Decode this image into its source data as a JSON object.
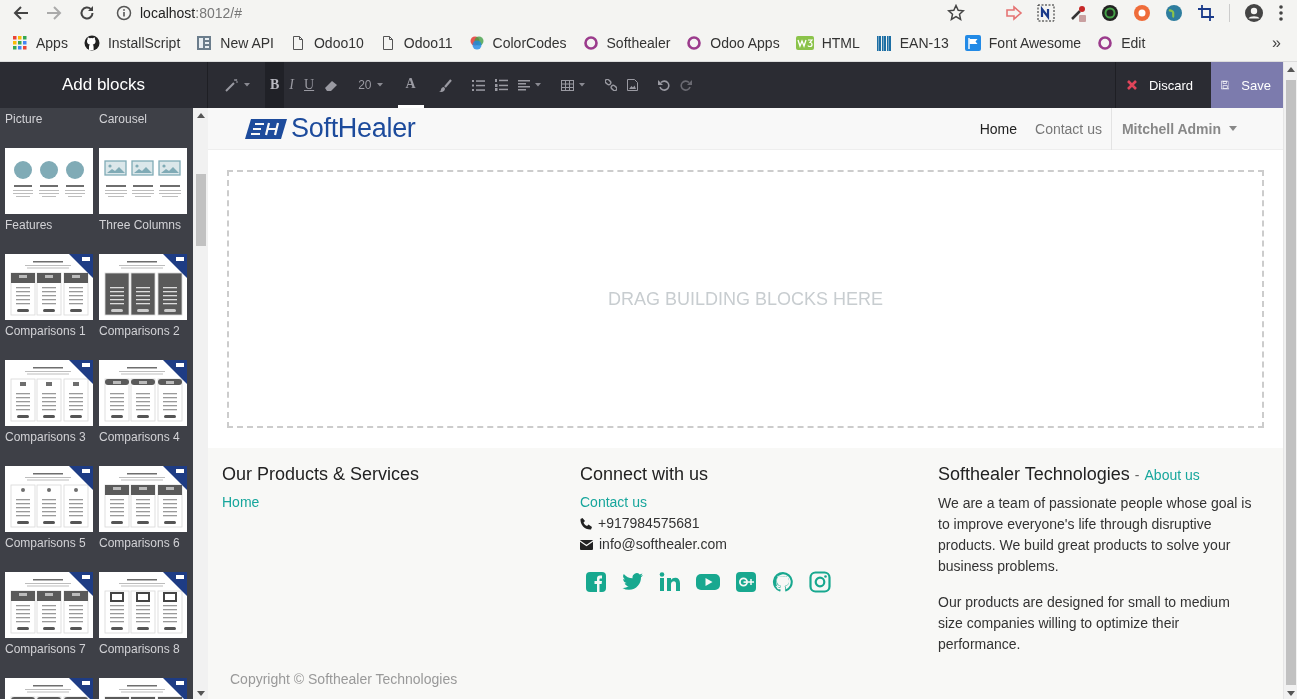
{
  "browser": {
    "url_host": "localhost",
    "url_rest": ":8012/#",
    "overflow": "»",
    "bookmarks": [
      {
        "label": "Apps",
        "kind": "grid"
      },
      {
        "label": "InstallScript",
        "kind": "github"
      },
      {
        "label": "New API",
        "kind": "panel"
      },
      {
        "label": "Odoo10",
        "kind": "page"
      },
      {
        "label": "Odoo11",
        "kind": "page"
      },
      {
        "label": "ColorCodes",
        "kind": "color"
      },
      {
        "label": "Softhealer",
        "kind": "ring"
      },
      {
        "label": "Odoo Apps",
        "kind": "ring"
      },
      {
        "label": "HTML",
        "kind": "w3"
      },
      {
        "label": "EAN-13",
        "kind": "barcode"
      },
      {
        "label": "Font Awesome",
        "kind": "flag"
      },
      {
        "label": "Edit",
        "kind": "ring"
      }
    ]
  },
  "editor_bar": {
    "title": "Add blocks",
    "bold": {
      "label": "B",
      "on": true
    },
    "italic": "I",
    "underline": "U",
    "font_size": "20",
    "text_color": "A",
    "discard": "Discard",
    "save": "Save"
  },
  "blocks": [
    {
      "label": "Picture"
    },
    {
      "label": "Carousel"
    },
    {
      "label": "Features",
      "kind": "circles"
    },
    {
      "label": "Three Columns",
      "kind": "images"
    },
    {
      "label": "Comparisons 1",
      "kind": "table-light"
    },
    {
      "label": "Comparisons 2",
      "kind": "table-dark"
    },
    {
      "label": "Comparisons 3",
      "kind": "table-plain"
    },
    {
      "label": "Comparisons 4",
      "kind": "table-tabbed"
    },
    {
      "label": "Comparisons 5",
      "kind": "table-dot"
    },
    {
      "label": "Comparisons 6",
      "kind": "table-banded"
    },
    {
      "label": "Comparisons 7",
      "kind": "table-light"
    },
    {
      "label": "Comparisons 8",
      "kind": "table-boxed"
    },
    {
      "kind": "table-tabbed"
    },
    {
      "kind": "table-banded"
    }
  ],
  "site": {
    "logo": "SoftHealer",
    "nav": [
      {
        "label": "Home",
        "selected": true
      },
      {
        "label": "Contact us",
        "selected": false
      }
    ],
    "user": "Mitchell Admin"
  },
  "drop_zone": "DRAG BUILDING BLOCKS HERE",
  "footer": {
    "products": {
      "title": "Our Products & Services",
      "links": [
        "Home"
      ]
    },
    "connect": {
      "title": "Connect with us",
      "link": "Contact us",
      "phone": "+917984575681",
      "email": "info@softhealer.com",
      "social": [
        {
          "kind": "facebook"
        },
        {
          "kind": "twitter"
        },
        {
          "kind": "linkedin"
        },
        {
          "kind": "youtube"
        },
        {
          "kind": "google-plus"
        },
        {
          "kind": "github"
        },
        {
          "kind": "instagram"
        }
      ]
    },
    "about": {
      "title": "Softhealer Technologies",
      "separator": "-",
      "link": "About us",
      "paragraphs": [
        "We are a team of passionate people whose goal is to improve everyone's life through disruptive products. We build great products to solve your business problems.",
        "Our products are designed for small to medium size companies willing to optimize their performance."
      ]
    },
    "copyright": "Copyright © Softhealer Technologies"
  }
}
